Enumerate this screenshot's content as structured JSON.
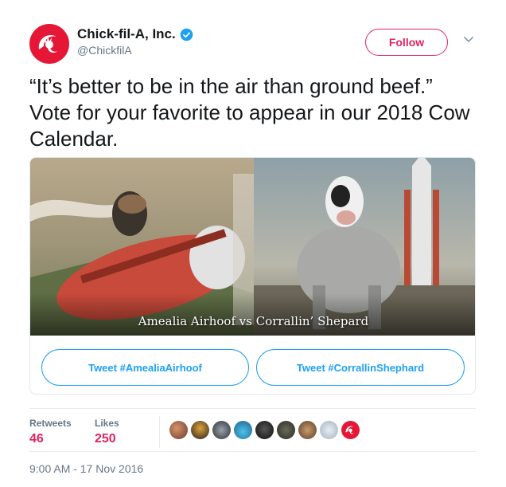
{
  "author": {
    "name": "Chick-fil-A, Inc.",
    "handle": "@ChickfilA",
    "brand_color": "#e51636",
    "verified_icon": "verified-badge-icon"
  },
  "follow_label": "Follow",
  "tweet_text": "“It’s better to be in the air than ground beef.” Vote for your favorite to appear in our 2018 Cow Calendar.",
  "card": {
    "caption": "Amealia Airhoof vs Corrallin’ Shepard",
    "buttons": [
      {
        "label": "Tweet #AmealiaAirhoof"
      },
      {
        "label": "Tweet #CorrallinShephard"
      }
    ]
  },
  "stats": {
    "retweets_label": "Retweets",
    "retweets_value": "46",
    "likes_label": "Likes",
    "likes_value": "250"
  },
  "timestamp": "9:00 AM - 17 Nov 2016",
  "colors": {
    "accent": "#1da1f2",
    "like_red": "#e0245e",
    "muted": "#657786"
  }
}
